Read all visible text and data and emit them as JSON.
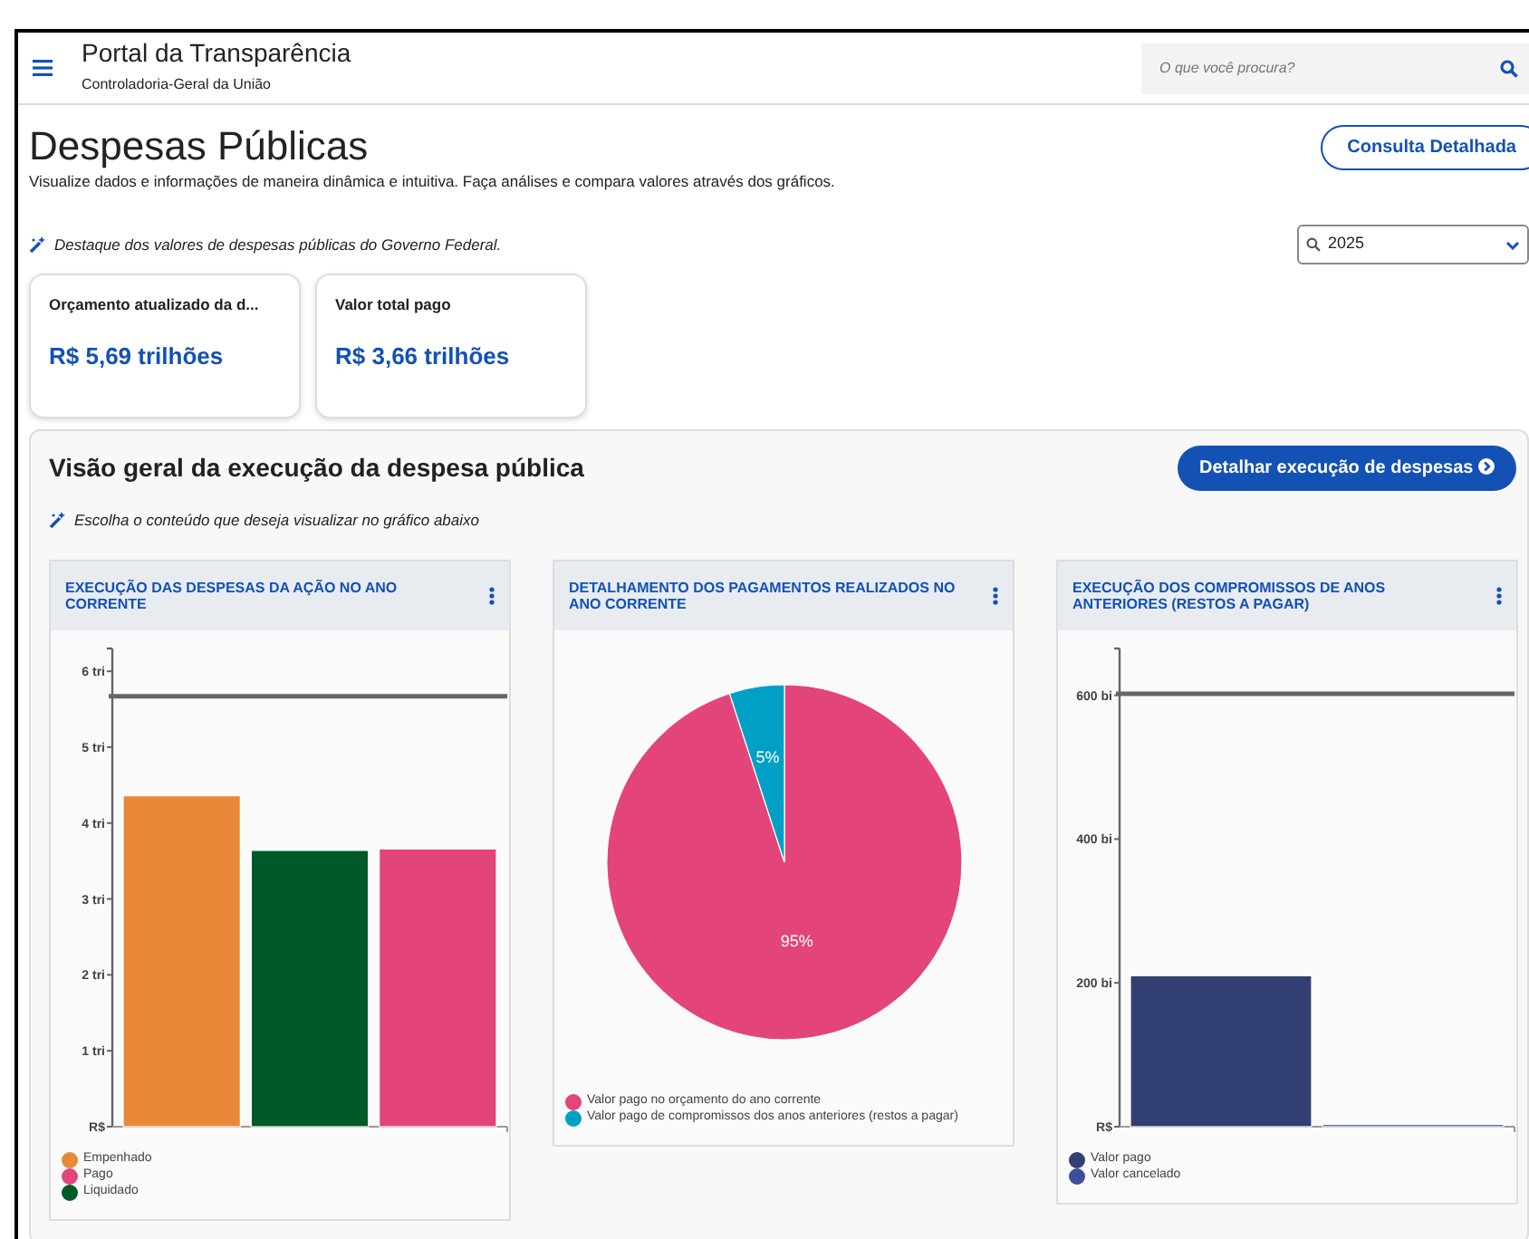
{
  "header": {
    "title": "Portal da Transparência",
    "subtitle": "Controladoria-Geral da União",
    "search": {
      "placeholder": "O que você procura?"
    }
  },
  "page": {
    "title": "Despesas Públicas",
    "description": "Visualize dados e informações de maneira dinâmica e intuitiva. Faça análises e compara valores através dos gráficos.",
    "action": "Consulta Detalhada"
  },
  "highlight": {
    "note": "Destaque dos valores de despesas públicas do Governo Federal.",
    "year": "2025"
  },
  "kpis": [
    {
      "label": "Orçamento atualizado da d...",
      "value": "R$ 5,69 trilhões"
    },
    {
      "label": "Valor total pago",
      "value": "R$ 3,66 trilhões"
    }
  ],
  "overview": {
    "title": "Visão geral da execução da despesa pública",
    "note": "Escolha o conteúdo que deseja visualizar no gráfico abaixo",
    "action": "Detalhar execução de despesas"
  },
  "charts": [
    {
      "title": "EXECUÇÃO DAS DESPESAS DA AÇÃO NO ANO CORRENTE",
      "chart_data": {
        "type": "bar",
        "ylim": [
          0,
          6.3
        ],
        "yticks": [
          {
            "value": 0,
            "label": "R$"
          },
          {
            "value": 1,
            "label": "1 tri"
          },
          {
            "value": 2,
            "label": "2 tri"
          },
          {
            "value": 3,
            "label": "3 tri"
          },
          {
            "value": 4,
            "label": "4 tri"
          },
          {
            "value": 5,
            "label": "5 tri"
          },
          {
            "value": 6,
            "label": "6 tri"
          }
        ],
        "ref_lines": [
          {
            "axis": "y",
            "value": 5.67
          }
        ],
        "series": [
          {
            "name": "Empenhado",
            "color": "#e8893a",
            "values": [
              4.36,
              null,
              null
            ]
          },
          {
            "name": "Pago",
            "color": "#e3457a",
            "values": [
              null,
              null,
              3.66
            ]
          },
          {
            "name": "Liquidado",
            "color": "#005a28",
            "values": [
              null,
              3.64,
              null
            ]
          }
        ]
      }
    },
    {
      "title": "DETALHAMENTO DOS PAGAMENTOS REALIZADOS NO ANO CORRENTE",
      "chart_data": {
        "type": "pie",
        "data_labels": true,
        "categories": [
          "Valor pago no orçamento do ano corrente",
          "Valor pago de compromissos dos anos anteriores (restos a pagar)"
        ],
        "values": [
          95,
          5
        ],
        "value_labels": [
          "95%",
          "5%"
        ],
        "colors": [
          "#e3457a",
          "#00a0c6"
        ]
      }
    },
    {
      "title": "EXECUÇÃO DOS COMPROMISSOS DE ANOS ANTERIORES (RESTOS A PAGAR)",
      "chart_data": {
        "type": "bar",
        "ylim": [
          0,
          665
        ],
        "yticks": [
          {
            "value": 0,
            "label": "R$"
          },
          {
            "value": 200,
            "label": "200 bi"
          },
          {
            "value": 400,
            "label": "400 bi"
          },
          {
            "value": 600,
            "label": "600 bi"
          }
        ],
        "ref_lines": [
          {
            "axis": "y",
            "value": 602
          }
        ],
        "series": [
          {
            "name": "Valor pago",
            "color": "#323f72",
            "values": [
              210,
              null
            ]
          },
          {
            "name": "Valor cancelado",
            "color": "#3d4f99",
            "values": [
              null,
              3
            ]
          }
        ]
      }
    }
  ]
}
